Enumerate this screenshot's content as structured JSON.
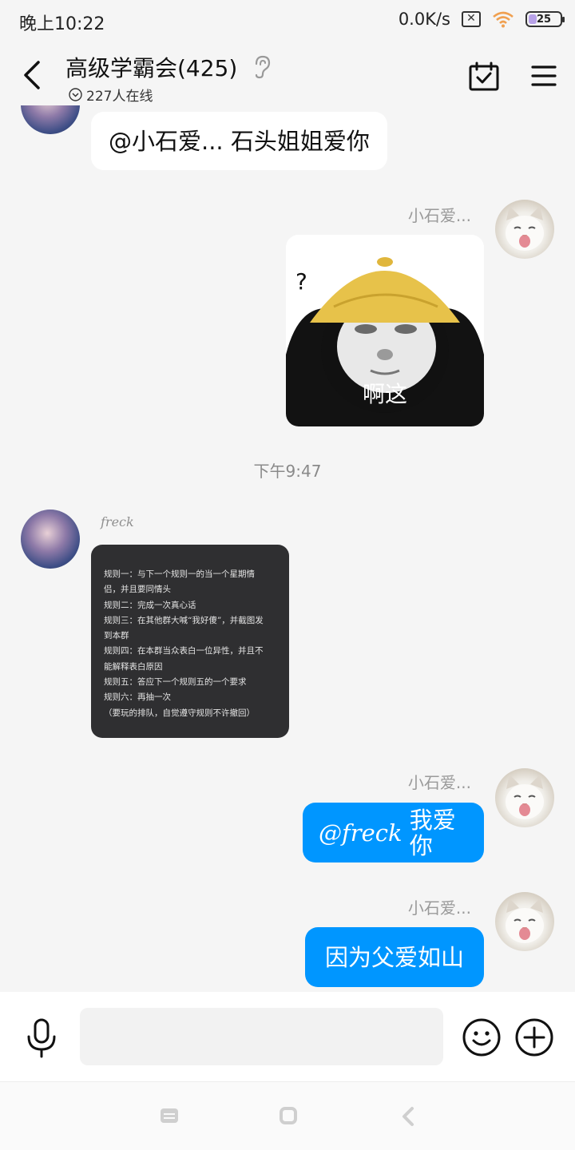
{
  "status_bar": {
    "time": "晚上10:22",
    "net_speed": "0.0K/s",
    "sim_icon": "sim-off-icon",
    "wifi_icon": "wifi-icon",
    "battery_level": "25",
    "battery_fraction": 0.25
  },
  "header": {
    "title": "高级学霸会(425)",
    "online_count": "227人在线",
    "icons": [
      "back-arrow-icon",
      "ear-icon",
      "calendar-check-icon",
      "menu-icon"
    ]
  },
  "messages": [
    {
      "sender_side": "left",
      "text": "@小石爱... 石头姐姐爱你"
    },
    {
      "sender_side": "right",
      "sender": "小石爱...",
      "sticker_caption": "啊这"
    },
    {
      "timestamp": "下午9:47"
    },
    {
      "sender_side": "left",
      "sender": "freck",
      "image_lines": [
        "规则一：与下一个规则一的当一个星期情",
        "侣，并且要同情头",
        "规则二：完成一次真心话",
        "规则三：在其他群大喊“我好傻”，并截图发",
        "到本群",
        "规则四：在本群当众表白一位异性，并且不",
        "能解释表白原因",
        "规则五：答应下一个规则五的一个要求",
        "规则六：再抽一次",
        "（要玩的排队，自觉遵守规则不许撤回）"
      ]
    },
    {
      "sender_side": "right",
      "sender": "小石爱...",
      "mention": "@freck",
      "text": "我爱你"
    },
    {
      "sender_side": "right",
      "sender": "小石爱...",
      "text": "因为父爱如山"
    }
  ],
  "input_bar": {
    "placeholder": "",
    "icons": [
      "microphone-icon",
      "emoji-icon",
      "plus-icon"
    ]
  },
  "colors": {
    "accent_blue": "#0096ff",
    "background": "#f5f5f5"
  }
}
